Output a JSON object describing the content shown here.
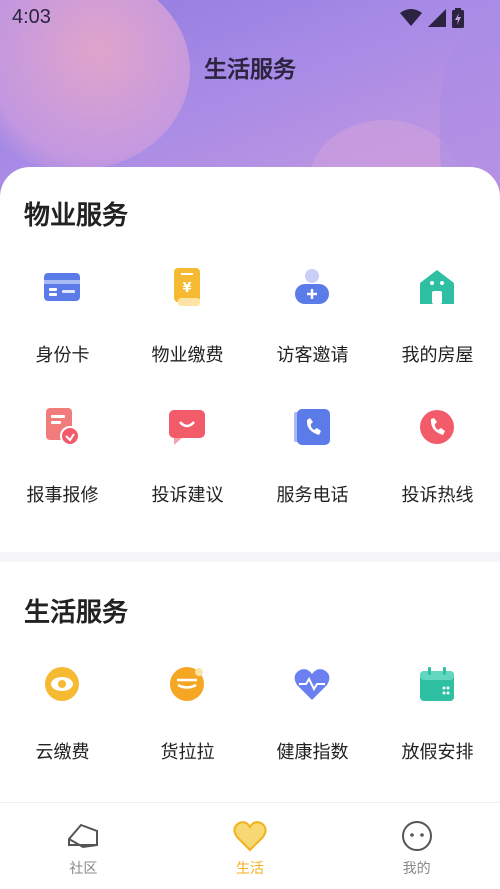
{
  "status_bar": {
    "time": "4:03"
  },
  "header": {
    "title": "生活服务"
  },
  "colors": {
    "accent": "#f2b21c",
    "header_start": "#8f7be0",
    "header_end": "#c79bdf"
  },
  "property_section": {
    "title": "物业服务",
    "items": [
      {
        "label": "身份卡",
        "icon": "id-card-icon"
      },
      {
        "label": "物业缴费",
        "icon": "property-fee-icon"
      },
      {
        "label": "访客邀请",
        "icon": "visitor-invite-icon"
      },
      {
        "label": "我的房屋",
        "icon": "house-icon"
      },
      {
        "label": "报事报修",
        "icon": "repair-report-icon"
      },
      {
        "label": "投诉建议",
        "icon": "complaint-suggestion-icon"
      },
      {
        "label": "服务电话",
        "icon": "service-phone-icon"
      },
      {
        "label": "投诉热线",
        "icon": "complaint-hotline-icon"
      }
    ]
  },
  "life_section": {
    "title": "生活服务",
    "items": [
      {
        "label": "云缴费",
        "icon": "cloud-payment-icon"
      },
      {
        "label": "货拉拉",
        "icon": "lalamove-icon"
      },
      {
        "label": "健康指数",
        "icon": "health-index-icon"
      },
      {
        "label": "放假安排",
        "icon": "holiday-calendar-icon"
      }
    ]
  },
  "bottom_nav": {
    "items": [
      {
        "label": "社区",
        "icon": "community-icon",
        "active": false
      },
      {
        "label": "生活",
        "icon": "life-heart-icon",
        "active": true
      },
      {
        "label": "我的",
        "icon": "profile-icon",
        "active": false
      }
    ]
  }
}
